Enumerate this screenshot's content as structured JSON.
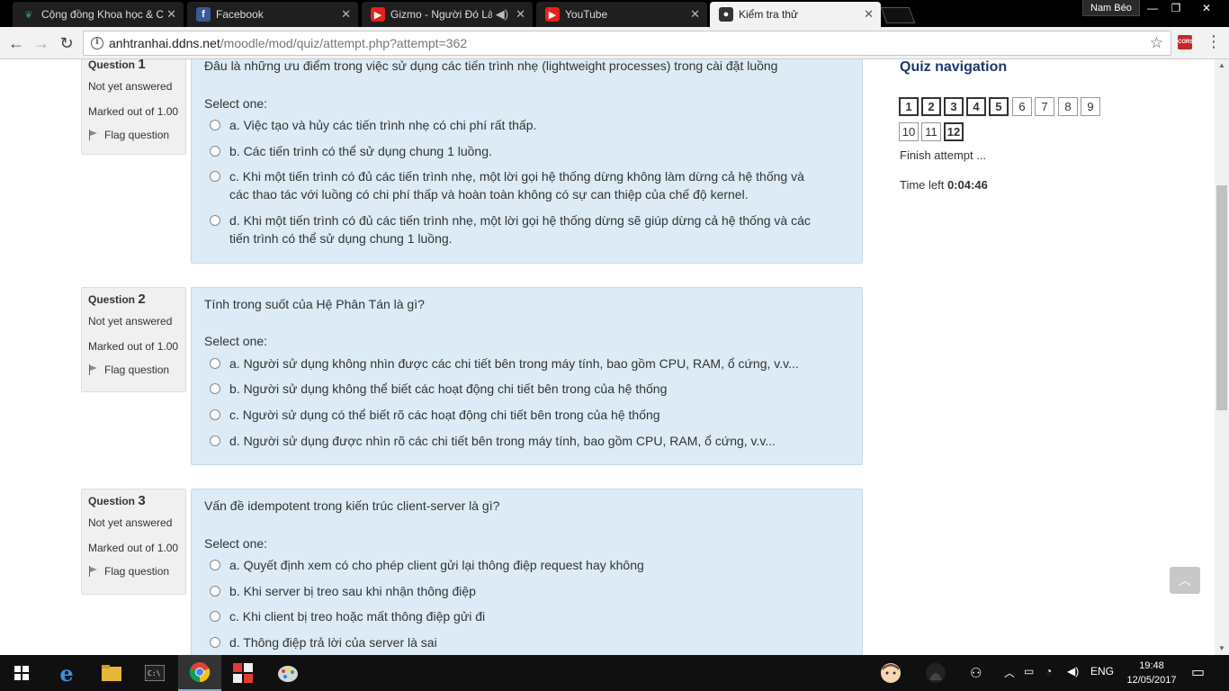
{
  "browser": {
    "tabs": [
      {
        "title": "Cộng đồng Khoa học & C",
        "icon": "leaf-icon",
        "active": false
      },
      {
        "title": "Facebook",
        "icon": "facebook-icon",
        "active": false
      },
      {
        "title": "Gizmo - Người Đó Là",
        "icon": "youtube-icon",
        "active": false
      },
      {
        "title": "YouTube",
        "icon": "youtube-icon",
        "active": false
      },
      {
        "title": "Kiểm tra thử",
        "icon": "user-icon",
        "active": true
      }
    ],
    "profile_name": "Nam Béo",
    "url_host": "anhtranhai.ddns.net",
    "url_path": "/moodle/mod/quiz/attempt.php?attempt=362",
    "cors_label": "CORS"
  },
  "questions": [
    {
      "label": "Question",
      "number": "1",
      "state": "Not yet answered",
      "grade": "Marked out of 1.00",
      "flag": "Flag question",
      "text": "Đâu là những ưu điểm trong việc sử dụng các tiến trình nhẹ (lightweight processes) trong cài đặt luồng",
      "prompt": "Select one:",
      "options": [
        "a. Việc tạo và hủy các tiến trình nhẹ có chi phí rất thấp.",
        "b. Các tiến trình có thể sử dụng chung 1 luồng.",
        "c. Khi một tiến trình có đủ các tiến trình nhẹ, một lời gọi hệ thống dừng không làm dừng cả hệ thống và các thao tác với luồng có chi phí thấp và hoàn toàn không có sự can thiệp của chế độ kernel.",
        "d. Khi một tiến trình có đủ các tiến trình nhẹ, một lời gọi hệ thống dừng sẽ giúp dừng cả hệ thống và các tiến trình có thể sử dụng chung 1 luồng."
      ]
    },
    {
      "label": "Question",
      "number": "2",
      "state": "Not yet answered",
      "grade": "Marked out of 1.00",
      "flag": "Flag question",
      "text": "Tính trong suốt của Hệ Phân Tán là gì?",
      "prompt": "Select one:",
      "options": [
        "a. Người sử dụng không nhìn được các chi tiết bên trong máy tính, bao gồm CPU, RAM, ổ cứng, v.v...",
        "b. Người sử dụng không thể biết các hoạt động chi tiết bên trong của hệ thống",
        "c. Người sử dụng có thể biết rõ các hoạt động chi tiết bên trong của hệ thống",
        "d. Người sử dụng được nhìn rõ các chi tiết bên trong máy tính, bao gồm CPU, RAM, ổ cứng, v.v..."
      ]
    },
    {
      "label": "Question",
      "number": "3",
      "state": "Not yet answered",
      "grade": "Marked out of 1.00",
      "flag": "Flag question",
      "text": "Vấn đề idempotent trong kiến trúc client-server là gì?",
      "prompt": "Select one:",
      "options": [
        "a. Quyết định xem có cho phép client gửi lại thông điệp request hay không",
        "b. Khi server bị treo sau khi nhận thông điệp",
        "c. Khi client bị treo hoặc mất thông điệp gửi đi",
        "d. Thông điệp trả lời của server là sai"
      ]
    }
  ],
  "quiz_nav": {
    "title": "Quiz navigation",
    "buttons": [
      "1",
      "2",
      "3",
      "4",
      "5",
      "6",
      "7",
      "8",
      "9",
      "10",
      "11",
      "12"
    ],
    "finish": "Finish attempt ...",
    "time_label": "Time left",
    "time_value": "0:04:46"
  },
  "taskbar": {
    "language": "ENG",
    "time": "19:48",
    "date": "12/05/2017"
  }
}
